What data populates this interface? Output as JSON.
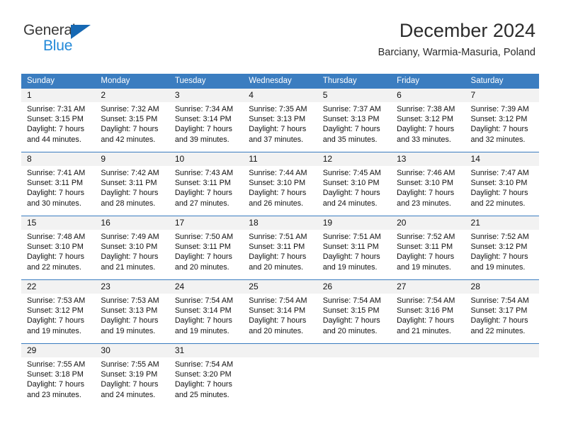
{
  "brand": {
    "name_part1": "General",
    "name_part2": "Blue",
    "logo_icon": "triangle-logo-icon"
  },
  "header": {
    "title": "December 2024",
    "subtitle": "Barciany, Warmia-Masuria, Poland"
  },
  "colors": {
    "header_blue": "#3b7dc0",
    "brand_blue": "#2389d8",
    "logo_blue": "#1668b3",
    "day_band_gray": "#f2f2f2",
    "text": "#111111"
  },
  "weekdays": [
    "Sunday",
    "Monday",
    "Tuesday",
    "Wednesday",
    "Thursday",
    "Friday",
    "Saturday"
  ],
  "labels": {
    "sunrise_prefix": "Sunrise:",
    "sunset_prefix": "Sunset:",
    "daylight_prefix": "Daylight:"
  },
  "weeks": [
    [
      {
        "day": "1",
        "sunrise": "Sunrise: 7:31 AM",
        "sunset": "Sunset: 3:15 PM",
        "daylight1": "Daylight: 7 hours",
        "daylight2": "and 44 minutes."
      },
      {
        "day": "2",
        "sunrise": "Sunrise: 7:32 AM",
        "sunset": "Sunset: 3:15 PM",
        "daylight1": "Daylight: 7 hours",
        "daylight2": "and 42 minutes."
      },
      {
        "day": "3",
        "sunrise": "Sunrise: 7:34 AM",
        "sunset": "Sunset: 3:14 PM",
        "daylight1": "Daylight: 7 hours",
        "daylight2": "and 39 minutes."
      },
      {
        "day": "4",
        "sunrise": "Sunrise: 7:35 AM",
        "sunset": "Sunset: 3:13 PM",
        "daylight1": "Daylight: 7 hours",
        "daylight2": "and 37 minutes."
      },
      {
        "day": "5",
        "sunrise": "Sunrise: 7:37 AM",
        "sunset": "Sunset: 3:13 PM",
        "daylight1": "Daylight: 7 hours",
        "daylight2": "and 35 minutes."
      },
      {
        "day": "6",
        "sunrise": "Sunrise: 7:38 AM",
        "sunset": "Sunset: 3:12 PM",
        "daylight1": "Daylight: 7 hours",
        "daylight2": "and 33 minutes."
      },
      {
        "day": "7",
        "sunrise": "Sunrise: 7:39 AM",
        "sunset": "Sunset: 3:12 PM",
        "daylight1": "Daylight: 7 hours",
        "daylight2": "and 32 minutes."
      }
    ],
    [
      {
        "day": "8",
        "sunrise": "Sunrise: 7:41 AM",
        "sunset": "Sunset: 3:11 PM",
        "daylight1": "Daylight: 7 hours",
        "daylight2": "and 30 minutes."
      },
      {
        "day": "9",
        "sunrise": "Sunrise: 7:42 AM",
        "sunset": "Sunset: 3:11 PM",
        "daylight1": "Daylight: 7 hours",
        "daylight2": "and 28 minutes."
      },
      {
        "day": "10",
        "sunrise": "Sunrise: 7:43 AM",
        "sunset": "Sunset: 3:11 PM",
        "daylight1": "Daylight: 7 hours",
        "daylight2": "and 27 minutes."
      },
      {
        "day": "11",
        "sunrise": "Sunrise: 7:44 AM",
        "sunset": "Sunset: 3:10 PM",
        "daylight1": "Daylight: 7 hours",
        "daylight2": "and 26 minutes."
      },
      {
        "day": "12",
        "sunrise": "Sunrise: 7:45 AM",
        "sunset": "Sunset: 3:10 PM",
        "daylight1": "Daylight: 7 hours",
        "daylight2": "and 24 minutes."
      },
      {
        "day": "13",
        "sunrise": "Sunrise: 7:46 AM",
        "sunset": "Sunset: 3:10 PM",
        "daylight1": "Daylight: 7 hours",
        "daylight2": "and 23 minutes."
      },
      {
        "day": "14",
        "sunrise": "Sunrise: 7:47 AM",
        "sunset": "Sunset: 3:10 PM",
        "daylight1": "Daylight: 7 hours",
        "daylight2": "and 22 minutes."
      }
    ],
    [
      {
        "day": "15",
        "sunrise": "Sunrise: 7:48 AM",
        "sunset": "Sunset: 3:10 PM",
        "daylight1": "Daylight: 7 hours",
        "daylight2": "and 22 minutes."
      },
      {
        "day": "16",
        "sunrise": "Sunrise: 7:49 AM",
        "sunset": "Sunset: 3:10 PM",
        "daylight1": "Daylight: 7 hours",
        "daylight2": "and 21 minutes."
      },
      {
        "day": "17",
        "sunrise": "Sunrise: 7:50 AM",
        "sunset": "Sunset: 3:11 PM",
        "daylight1": "Daylight: 7 hours",
        "daylight2": "and 20 minutes."
      },
      {
        "day": "18",
        "sunrise": "Sunrise: 7:51 AM",
        "sunset": "Sunset: 3:11 PM",
        "daylight1": "Daylight: 7 hours",
        "daylight2": "and 20 minutes."
      },
      {
        "day": "19",
        "sunrise": "Sunrise: 7:51 AM",
        "sunset": "Sunset: 3:11 PM",
        "daylight1": "Daylight: 7 hours",
        "daylight2": "and 19 minutes."
      },
      {
        "day": "20",
        "sunrise": "Sunrise: 7:52 AM",
        "sunset": "Sunset: 3:11 PM",
        "daylight1": "Daylight: 7 hours",
        "daylight2": "and 19 minutes."
      },
      {
        "day": "21",
        "sunrise": "Sunrise: 7:52 AM",
        "sunset": "Sunset: 3:12 PM",
        "daylight1": "Daylight: 7 hours",
        "daylight2": "and 19 minutes."
      }
    ],
    [
      {
        "day": "22",
        "sunrise": "Sunrise: 7:53 AM",
        "sunset": "Sunset: 3:12 PM",
        "daylight1": "Daylight: 7 hours",
        "daylight2": "and 19 minutes."
      },
      {
        "day": "23",
        "sunrise": "Sunrise: 7:53 AM",
        "sunset": "Sunset: 3:13 PM",
        "daylight1": "Daylight: 7 hours",
        "daylight2": "and 19 minutes."
      },
      {
        "day": "24",
        "sunrise": "Sunrise: 7:54 AM",
        "sunset": "Sunset: 3:14 PM",
        "daylight1": "Daylight: 7 hours",
        "daylight2": "and 19 minutes."
      },
      {
        "day": "25",
        "sunrise": "Sunrise: 7:54 AM",
        "sunset": "Sunset: 3:14 PM",
        "daylight1": "Daylight: 7 hours",
        "daylight2": "and 20 minutes."
      },
      {
        "day": "26",
        "sunrise": "Sunrise: 7:54 AM",
        "sunset": "Sunset: 3:15 PM",
        "daylight1": "Daylight: 7 hours",
        "daylight2": "and 20 minutes."
      },
      {
        "day": "27",
        "sunrise": "Sunrise: 7:54 AM",
        "sunset": "Sunset: 3:16 PM",
        "daylight1": "Daylight: 7 hours",
        "daylight2": "and 21 minutes."
      },
      {
        "day": "28",
        "sunrise": "Sunrise: 7:54 AM",
        "sunset": "Sunset: 3:17 PM",
        "daylight1": "Daylight: 7 hours",
        "daylight2": "and 22 minutes."
      }
    ],
    [
      {
        "day": "29",
        "sunrise": "Sunrise: 7:55 AM",
        "sunset": "Sunset: 3:18 PM",
        "daylight1": "Daylight: 7 hours",
        "daylight2": "and 23 minutes."
      },
      {
        "day": "30",
        "sunrise": "Sunrise: 7:55 AM",
        "sunset": "Sunset: 3:19 PM",
        "daylight1": "Daylight: 7 hours",
        "daylight2": "and 24 minutes."
      },
      {
        "day": "31",
        "sunrise": "Sunrise: 7:54 AM",
        "sunset": "Sunset: 3:20 PM",
        "daylight1": "Daylight: 7 hours",
        "daylight2": "and 25 minutes."
      },
      {
        "day": "",
        "sunrise": "",
        "sunset": "",
        "daylight1": "",
        "daylight2": ""
      },
      {
        "day": "",
        "sunrise": "",
        "sunset": "",
        "daylight1": "",
        "daylight2": ""
      },
      {
        "day": "",
        "sunrise": "",
        "sunset": "",
        "daylight1": "",
        "daylight2": ""
      },
      {
        "day": "",
        "sunrise": "",
        "sunset": "",
        "daylight1": "",
        "daylight2": ""
      }
    ]
  ]
}
